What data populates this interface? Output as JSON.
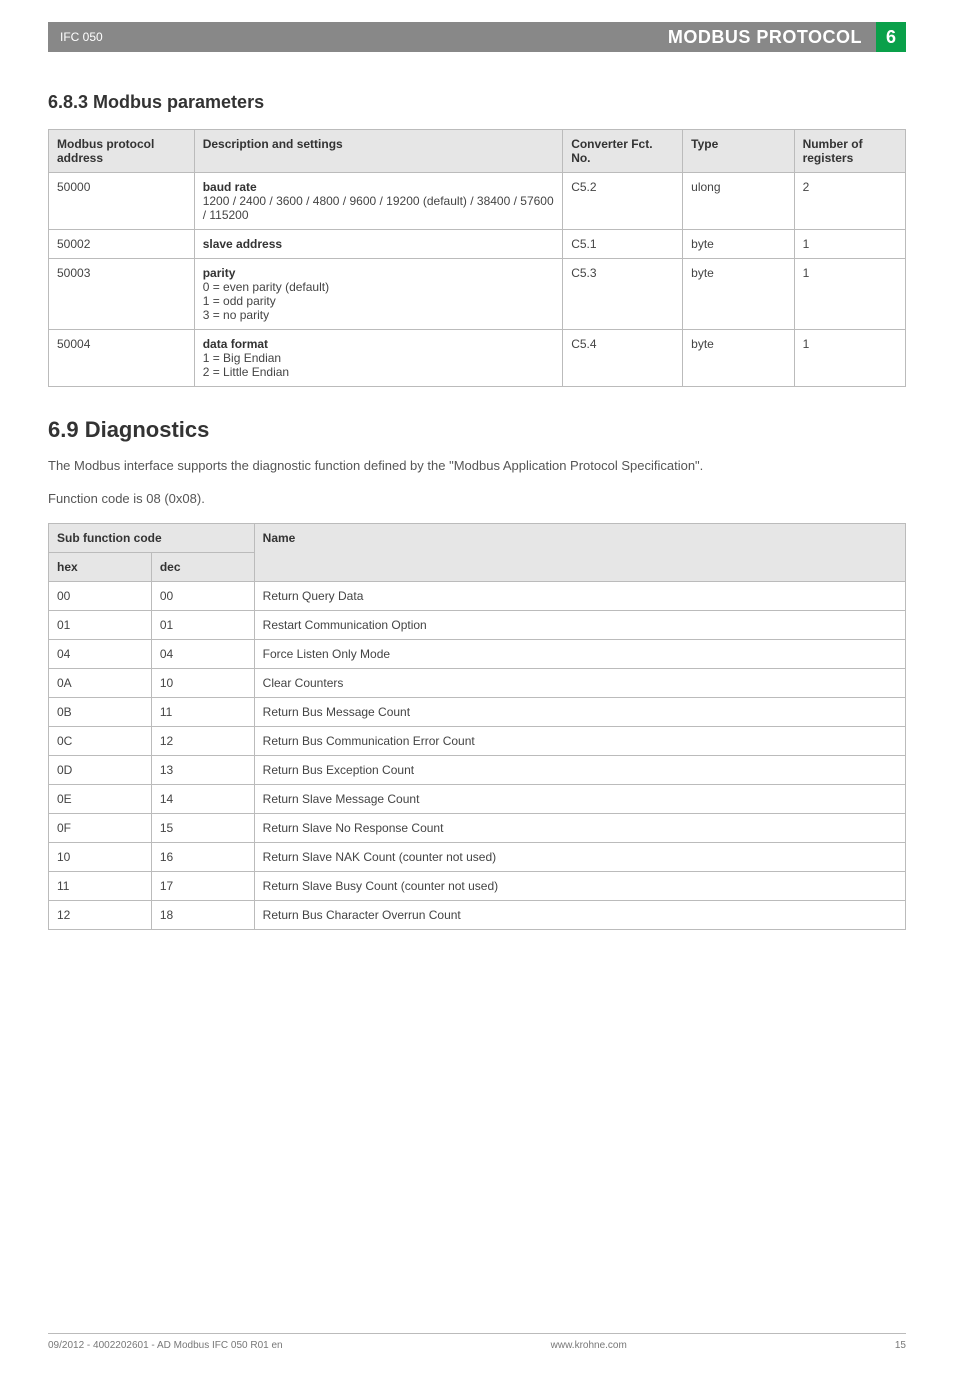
{
  "header": {
    "left": "IFC 050",
    "title": "MODBUS PROTOCOL",
    "chapter": "6"
  },
  "section_modbus_params": {
    "number_title": "6.8.3  Modbus parameters",
    "cols": {
      "c1": "Modbus protocol address",
      "c2": "Description and settings",
      "c3": "Converter Fct. No.",
      "c4": "Type",
      "c5": "Number of registers"
    },
    "rows": [
      {
        "addr": "50000",
        "desc_title": "baud rate",
        "desc_body": "1200 / 2400 / 3600 / 4800 / 9600 / 19200 (default) / 38400 / 57600 / 115200",
        "fct": "C5.2",
        "type": "ulong",
        "regs": "2"
      },
      {
        "addr": "50002",
        "desc_title": "slave address",
        "desc_body": "",
        "fct": "C5.1",
        "type": "byte",
        "regs": "1"
      },
      {
        "addr": "50003",
        "desc_title": "parity",
        "desc_body": "0 = even parity (default)\n1 = odd parity\n3 = no parity",
        "fct": "C5.3",
        "type": "byte",
        "regs": "1"
      },
      {
        "addr": "50004",
        "desc_title": "data format",
        "desc_body": "1 = Big Endian\n2 = Little Endian",
        "fct": "C5.4",
        "type": "byte",
        "regs": "1"
      }
    ]
  },
  "section_diag": {
    "number_title": "6.9  Diagnostics",
    "para1": "The Modbus interface supports the diagnostic function defined by the \"Modbus Application Protocol Specification\".",
    "para2": "Function code is 08 (0x08).",
    "header_span": "Sub function code",
    "header_name": "Name",
    "sub_hex": "hex",
    "sub_dec": "dec",
    "rows": [
      {
        "hex": "00",
        "dec": "00",
        "name": "Return Query Data"
      },
      {
        "hex": "01",
        "dec": "01",
        "name": "Restart Communication Option"
      },
      {
        "hex": "04",
        "dec": "04",
        "name": "Force Listen Only Mode"
      },
      {
        "hex": "0A",
        "dec": "10",
        "name": "Clear Counters"
      },
      {
        "hex": "0B",
        "dec": "11",
        "name": "Return Bus Message Count"
      },
      {
        "hex": "0C",
        "dec": "12",
        "name": "Return Bus Communication Error Count"
      },
      {
        "hex": "0D",
        "dec": "13",
        "name": "Return Bus Exception Count"
      },
      {
        "hex": "0E",
        "dec": "14",
        "name": "Return Slave Message Count"
      },
      {
        "hex": "0F",
        "dec": "15",
        "name": "Return Slave No Response Count"
      },
      {
        "hex": "10",
        "dec": "16",
        "name": "Return Slave NAK Count (counter not used)"
      },
      {
        "hex": "11",
        "dec": "17",
        "name": "Return Slave Busy Count (counter not used)"
      },
      {
        "hex": "12",
        "dec": "18",
        "name": "Return Bus Character Overrun Count"
      }
    ]
  },
  "footer": {
    "left": "09/2012 - 4002202601 - AD Modbus IFC 050 R01 en",
    "mid": "www.krohne.com",
    "right": "15"
  }
}
